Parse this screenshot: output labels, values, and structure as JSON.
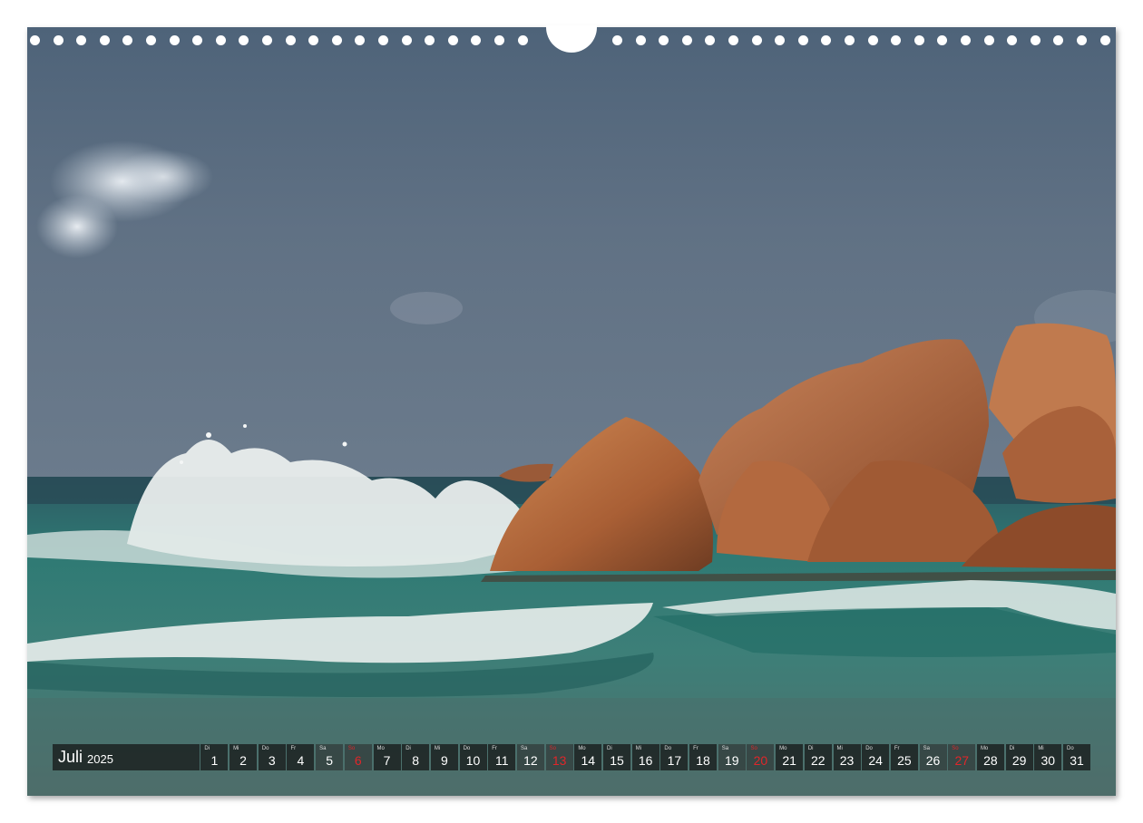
{
  "calendar": {
    "month": "Juli",
    "year": "2025",
    "days": [
      {
        "abbr": "Di",
        "num": "1"
      },
      {
        "abbr": "Mi",
        "num": "2"
      },
      {
        "abbr": "Do",
        "num": "3"
      },
      {
        "abbr": "Fr",
        "num": "4"
      },
      {
        "abbr": "Sa",
        "num": "5"
      },
      {
        "abbr": "So",
        "num": "6"
      },
      {
        "abbr": "Mo",
        "num": "7"
      },
      {
        "abbr": "Di",
        "num": "8"
      },
      {
        "abbr": "Mi",
        "num": "9"
      },
      {
        "abbr": "Do",
        "num": "10"
      },
      {
        "abbr": "Fr",
        "num": "11"
      },
      {
        "abbr": "Sa",
        "num": "12"
      },
      {
        "abbr": "So",
        "num": "13"
      },
      {
        "abbr": "Mo",
        "num": "14"
      },
      {
        "abbr": "Di",
        "num": "15"
      },
      {
        "abbr": "Mi",
        "num": "16"
      },
      {
        "abbr": "Do",
        "num": "17"
      },
      {
        "abbr": "Fr",
        "num": "18"
      },
      {
        "abbr": "Sa",
        "num": "19"
      },
      {
        "abbr": "So",
        "num": "20"
      },
      {
        "abbr": "Mo",
        "num": "21"
      },
      {
        "abbr": "Di",
        "num": "22"
      },
      {
        "abbr": "Mi",
        "num": "23"
      },
      {
        "abbr": "Do",
        "num": "24"
      },
      {
        "abbr": "Fr",
        "num": "25"
      },
      {
        "abbr": "Sa",
        "num": "26"
      },
      {
        "abbr": "So",
        "num": "27"
      },
      {
        "abbr": "Mo",
        "num": "28"
      },
      {
        "abbr": "Di",
        "num": "29"
      },
      {
        "abbr": "Mi",
        "num": "30"
      },
      {
        "abbr": "Do",
        "num": "31"
      }
    ]
  },
  "colors": {
    "sky": "#5f7084",
    "sea": "#2f6f6a",
    "rock": "#b0683e",
    "sunday": "#e0262a"
  },
  "photo": {
    "subject_icon": "seascape-photo"
  }
}
